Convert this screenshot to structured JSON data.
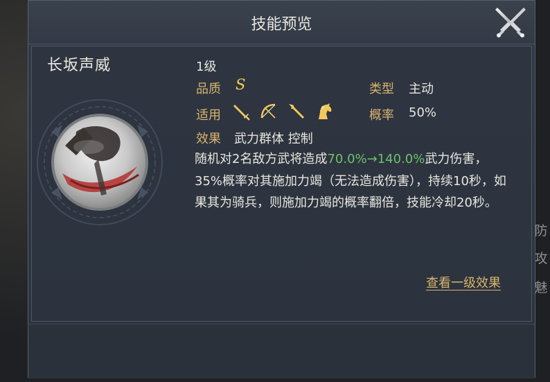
{
  "dialog": {
    "title": "技能预览",
    "close_icon": "close-crossed-swords-icon"
  },
  "skill": {
    "name": "长坂声威",
    "level": "1级",
    "quality_label": "品质",
    "quality_value": "S",
    "type_label": "类型",
    "type_value": "主动",
    "applies_label": "适用",
    "applies_icons": [
      "sword-icon",
      "bow-icon",
      "spear-icon",
      "horse-icon"
    ],
    "rate_label": "概率",
    "rate_value": "50%",
    "effect_label": "效果",
    "effect_value": "武力群体 控制",
    "description": {
      "part1": "随机对2名敌方武将造成",
      "highlight": "70.0%→140.0%",
      "part2": "武力伤害，35%概率对其施加力竭（无法造成伤害），持续10秒，如果其为骑兵，则施加力竭的概率翻倍，技能冷却20秒。"
    },
    "view_level1_link": "查看一级效果"
  },
  "background": {
    "side_texts": [
      "防",
      "攻",
      "魅"
    ]
  },
  "colors": {
    "label_gold": "#d9b46c",
    "highlight_green": "#6cc26a",
    "quality_yellow": "#f3d24d"
  }
}
